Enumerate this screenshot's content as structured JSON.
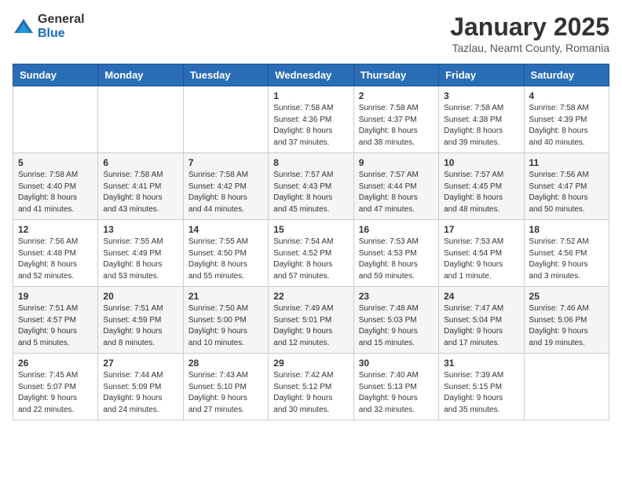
{
  "header": {
    "logo_general": "General",
    "logo_blue": "Blue",
    "month_title": "January 2025",
    "location": "Tazlau, Neamt County, Romania"
  },
  "days_of_week": [
    "Sunday",
    "Monday",
    "Tuesday",
    "Wednesday",
    "Thursday",
    "Friday",
    "Saturday"
  ],
  "weeks": [
    [
      {
        "day": "",
        "info": ""
      },
      {
        "day": "",
        "info": ""
      },
      {
        "day": "",
        "info": ""
      },
      {
        "day": "1",
        "info": "Sunrise: 7:58 AM\nSunset: 4:36 PM\nDaylight: 8 hours\nand 37 minutes."
      },
      {
        "day": "2",
        "info": "Sunrise: 7:58 AM\nSunset: 4:37 PM\nDaylight: 8 hours\nand 38 minutes."
      },
      {
        "day": "3",
        "info": "Sunrise: 7:58 AM\nSunset: 4:38 PM\nDaylight: 8 hours\nand 39 minutes."
      },
      {
        "day": "4",
        "info": "Sunrise: 7:58 AM\nSunset: 4:39 PM\nDaylight: 8 hours\nand 40 minutes."
      }
    ],
    [
      {
        "day": "5",
        "info": "Sunrise: 7:58 AM\nSunset: 4:40 PM\nDaylight: 8 hours\nand 41 minutes."
      },
      {
        "day": "6",
        "info": "Sunrise: 7:58 AM\nSunset: 4:41 PM\nDaylight: 8 hours\nand 43 minutes."
      },
      {
        "day": "7",
        "info": "Sunrise: 7:58 AM\nSunset: 4:42 PM\nDaylight: 8 hours\nand 44 minutes."
      },
      {
        "day": "8",
        "info": "Sunrise: 7:57 AM\nSunset: 4:43 PM\nDaylight: 8 hours\nand 45 minutes."
      },
      {
        "day": "9",
        "info": "Sunrise: 7:57 AM\nSunset: 4:44 PM\nDaylight: 8 hours\nand 47 minutes."
      },
      {
        "day": "10",
        "info": "Sunrise: 7:57 AM\nSunset: 4:45 PM\nDaylight: 8 hours\nand 48 minutes."
      },
      {
        "day": "11",
        "info": "Sunrise: 7:56 AM\nSunset: 4:47 PM\nDaylight: 8 hours\nand 50 minutes."
      }
    ],
    [
      {
        "day": "12",
        "info": "Sunrise: 7:56 AM\nSunset: 4:48 PM\nDaylight: 8 hours\nand 52 minutes."
      },
      {
        "day": "13",
        "info": "Sunrise: 7:55 AM\nSunset: 4:49 PM\nDaylight: 8 hours\nand 53 minutes."
      },
      {
        "day": "14",
        "info": "Sunrise: 7:55 AM\nSunset: 4:50 PM\nDaylight: 8 hours\nand 55 minutes."
      },
      {
        "day": "15",
        "info": "Sunrise: 7:54 AM\nSunset: 4:52 PM\nDaylight: 8 hours\nand 57 minutes."
      },
      {
        "day": "16",
        "info": "Sunrise: 7:53 AM\nSunset: 4:53 PM\nDaylight: 8 hours\nand 59 minutes."
      },
      {
        "day": "17",
        "info": "Sunrise: 7:53 AM\nSunset: 4:54 PM\nDaylight: 9 hours\nand 1 minute."
      },
      {
        "day": "18",
        "info": "Sunrise: 7:52 AM\nSunset: 4:56 PM\nDaylight: 9 hours\nand 3 minutes."
      }
    ],
    [
      {
        "day": "19",
        "info": "Sunrise: 7:51 AM\nSunset: 4:57 PM\nDaylight: 9 hours\nand 5 minutes."
      },
      {
        "day": "20",
        "info": "Sunrise: 7:51 AM\nSunset: 4:59 PM\nDaylight: 9 hours\nand 8 minutes."
      },
      {
        "day": "21",
        "info": "Sunrise: 7:50 AM\nSunset: 5:00 PM\nDaylight: 9 hours\nand 10 minutes."
      },
      {
        "day": "22",
        "info": "Sunrise: 7:49 AM\nSunset: 5:01 PM\nDaylight: 9 hours\nand 12 minutes."
      },
      {
        "day": "23",
        "info": "Sunrise: 7:48 AM\nSunset: 5:03 PM\nDaylight: 9 hours\nand 15 minutes."
      },
      {
        "day": "24",
        "info": "Sunrise: 7:47 AM\nSunset: 5:04 PM\nDaylight: 9 hours\nand 17 minutes."
      },
      {
        "day": "25",
        "info": "Sunrise: 7:46 AM\nSunset: 5:06 PM\nDaylight: 9 hours\nand 19 minutes."
      }
    ],
    [
      {
        "day": "26",
        "info": "Sunrise: 7:45 AM\nSunset: 5:07 PM\nDaylight: 9 hours\nand 22 minutes."
      },
      {
        "day": "27",
        "info": "Sunrise: 7:44 AM\nSunset: 5:09 PM\nDaylight: 9 hours\nand 24 minutes."
      },
      {
        "day": "28",
        "info": "Sunrise: 7:43 AM\nSunset: 5:10 PM\nDaylight: 9 hours\nand 27 minutes."
      },
      {
        "day": "29",
        "info": "Sunrise: 7:42 AM\nSunset: 5:12 PM\nDaylight: 9 hours\nand 30 minutes."
      },
      {
        "day": "30",
        "info": "Sunrise: 7:40 AM\nSunset: 5:13 PM\nDaylight: 9 hours\nand 32 minutes."
      },
      {
        "day": "31",
        "info": "Sunrise: 7:39 AM\nSunset: 5:15 PM\nDaylight: 9 hours\nand 35 minutes."
      },
      {
        "day": "",
        "info": ""
      }
    ]
  ]
}
